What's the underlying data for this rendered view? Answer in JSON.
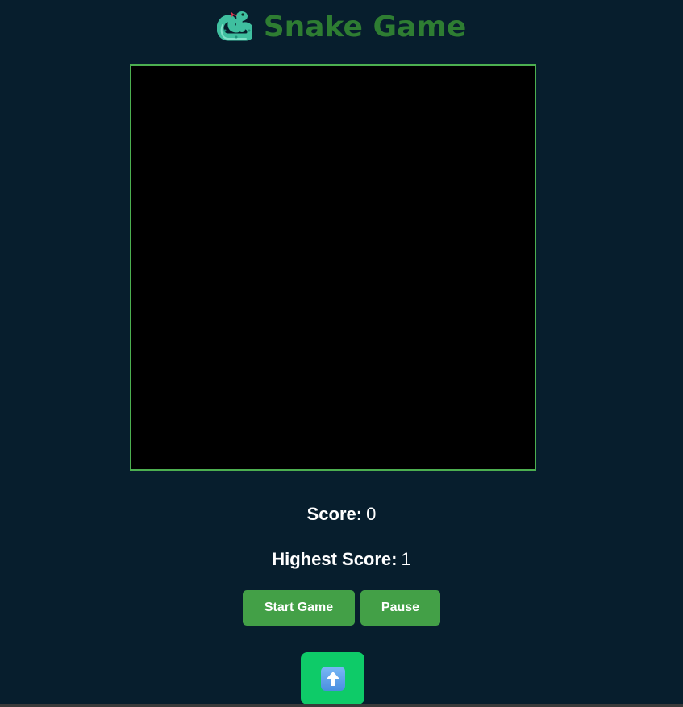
{
  "header": {
    "title": "Snake Game",
    "icon": "snake-icon",
    "title_color": "#2e7d32"
  },
  "board": {
    "background": "#000000",
    "border_color": "#4caf50"
  },
  "scoreboard": {
    "score_label": "Score:",
    "score_value": "0",
    "highest_label": "Highest Score:",
    "highest_value": "1"
  },
  "controls": {
    "start_label": "Start Game",
    "pause_label": "Pause",
    "button_color": "#43a047"
  },
  "scroll_top": {
    "icon": "up-arrow-icon",
    "color": "#0ecb68"
  },
  "theme": {
    "background": "#071e2d"
  }
}
